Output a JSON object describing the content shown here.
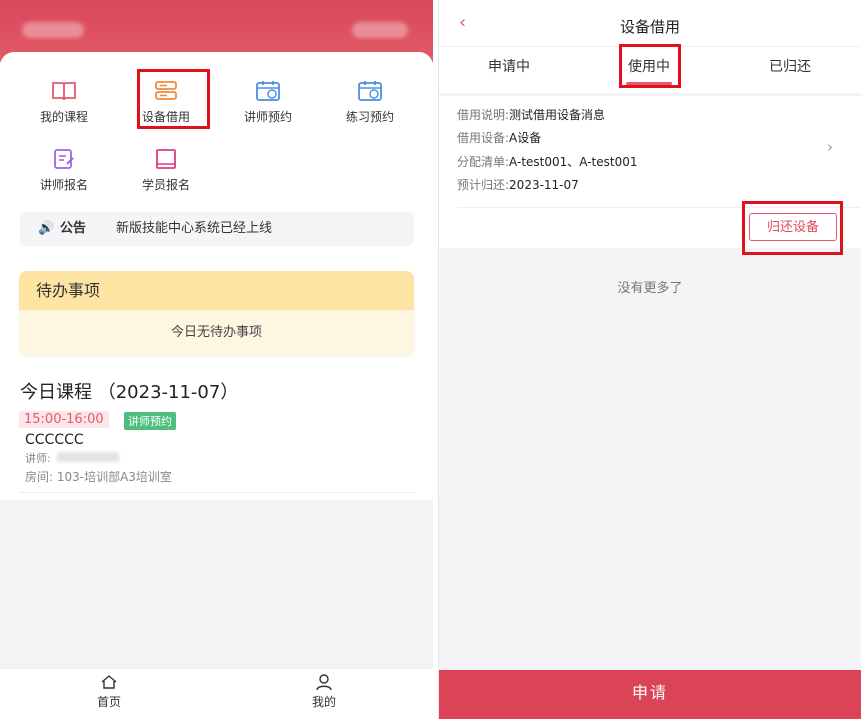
{
  "left": {
    "grid": [
      {
        "label": "我的课程",
        "icon": "book-icon"
      },
      {
        "label": "设备借用",
        "icon": "device-icon"
      },
      {
        "label": "讲师预约",
        "icon": "calendar-icon"
      },
      {
        "label": "练习预约",
        "icon": "calendar-clock-icon"
      },
      {
        "label": "讲师报名",
        "icon": "edit-doc-icon"
      },
      {
        "label": "学员报名",
        "icon": "notebook-icon"
      }
    ],
    "notice": {
      "tag": "公告",
      "text": "新版技能中心系统已经上线"
    },
    "todo": {
      "title": "待办事项",
      "empty": "今日无待办事项"
    },
    "today": {
      "title": "今日课程 （2023-11-07）",
      "time": "15:00-16:00",
      "badge": "讲师预约",
      "course": "CCCCCC",
      "teacher_label": "讲师:",
      "room": "房间: 103-培训部A3培训室"
    },
    "tabs": [
      {
        "label": "首页",
        "icon": "home-icon"
      },
      {
        "label": "我的",
        "icon": "user-icon"
      }
    ],
    "colors": {
      "brand": "#d8485a",
      "badge": "#4cbf7d",
      "todo_header": "#fde4a3"
    }
  },
  "right": {
    "title": "设备借用",
    "back_icon": "back-chevron-icon",
    "segments": [
      "申请中",
      "使用中",
      "已归还"
    ],
    "active_segment": "使用中",
    "record": {
      "desc_label": "借用说明:",
      "desc_value": "测试借用设备消息",
      "device_label": "借用设备:",
      "device_value": "A设备",
      "list_label": "分配清单:",
      "list_value": "A-test001、A-test001",
      "return_label": "预计归还:",
      "return_value": "2023-11-07"
    },
    "return_button": "归还设备",
    "no_more": "没有更多了",
    "submit": "申请"
  }
}
